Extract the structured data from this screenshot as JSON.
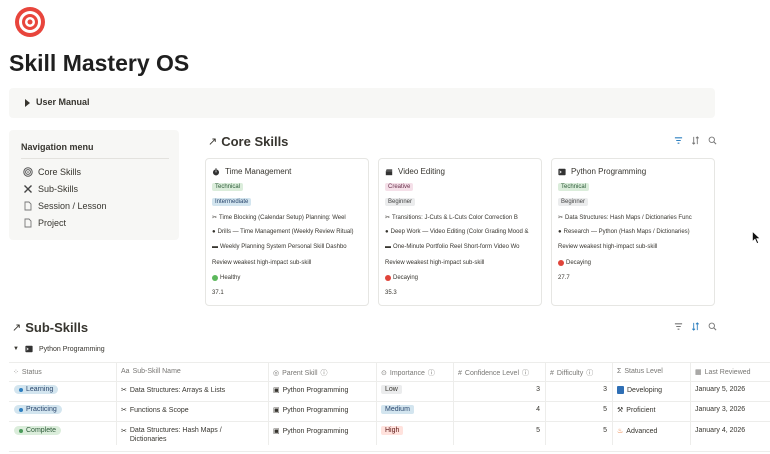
{
  "page": {
    "title": "Skill Mastery OS",
    "icon": "target-icon"
  },
  "toggle": {
    "label": "User Manual"
  },
  "nav": {
    "title": "Navigation menu",
    "items": [
      {
        "label": "Core Skills",
        "icon": "target-small-icon"
      },
      {
        "label": "Sub-Skills",
        "icon": "tools-icon"
      },
      {
        "label": "Session / Lesson",
        "icon": "document-icon"
      },
      {
        "label": "Project",
        "icon": "document-icon"
      }
    ]
  },
  "core": {
    "title": "Core Skills",
    "cards": [
      {
        "title": "Time Management",
        "tag1": "Technical",
        "tag2": "Intermediate",
        "subskills": "Time Blocking (Calendar Setup)  Planning: Weel",
        "sessions": "Drills — Time Management (Weekly Review Ritual)",
        "projects": "Weekly Planning System  Personal Skill Dashbo",
        "rec": "Review weakest high-impact sub-skill",
        "status": "Healthy",
        "status_color": "#5cb85c",
        "score": "37.1"
      },
      {
        "title": "Video Editing",
        "tag1": "Creative",
        "tag2": "Beginner",
        "subskills": "Transitions: J-Cuts & L-Cuts  Color Correction B",
        "sessions": "Deep Work — Video Editing (Color Grading Mood &",
        "projects": "One-Minute Portfolio Reel  Short-form Video Wo",
        "rec": "Review weakest high-impact sub-skill",
        "status": "Decaying",
        "status_color": "#e0443a",
        "score": "35.3"
      },
      {
        "title": "Python Programming",
        "tag1": "Technical",
        "tag2": "Beginner",
        "subskills": "Data Structures: Hash Maps / Dictionaries  Func",
        "sessions": "Research — Python (Hash Maps / Dictionaries)",
        "projects": "Review weakest high-impact sub-skill",
        "rec": "Decaying",
        "status_color": "#e0443a",
        "score": "27.7"
      }
    ]
  },
  "sub": {
    "title": "Sub-Skills",
    "group": "Python Programming",
    "columns": [
      "Status",
      "Sub-Skill Name",
      "Parent Skill",
      "Importance",
      "Confidence Level",
      "Difficulty",
      "Status Level",
      "Last Reviewed"
    ],
    "rows": [
      {
        "status": "Learning",
        "status_bg": "#d3e5ef",
        "status_dot": "#2f80c0",
        "name": "Data Structures: Arrays & Lists",
        "name2": "",
        "parent": "Python Programming",
        "importance": "Low",
        "imp_bg": "#ebeced",
        "confidence": "3",
        "difficulty": "3",
        "level": "Developing",
        "level_icon": "blue-book-icon",
        "date": "January 5, 2026"
      },
      {
        "status": "Practicing",
        "status_bg": "#d3e5ef",
        "status_dot": "#2f80c0",
        "name": "Functions & Scope",
        "name2": "",
        "parent": "Python Programming",
        "importance": "Medium",
        "imp_bg": "#d3e5ef",
        "confidence": "4",
        "difficulty": "5",
        "level": "Proficient",
        "level_icon": "hammer-icon",
        "date": "January 3, 2026"
      },
      {
        "status": "Complete",
        "status_bg": "#dbeddb",
        "status_dot": "#4a9a5a",
        "name": "Data Structures: Hash Maps /",
        "name2": "Dictionaries",
        "parent": "Python Programming",
        "importance": "High",
        "imp_bg": "#ffe2dd",
        "confidence": "5",
        "difficulty": "5",
        "level": "Advanced",
        "level_icon": "fire-icon",
        "date": "January 4, 2026"
      }
    ]
  }
}
